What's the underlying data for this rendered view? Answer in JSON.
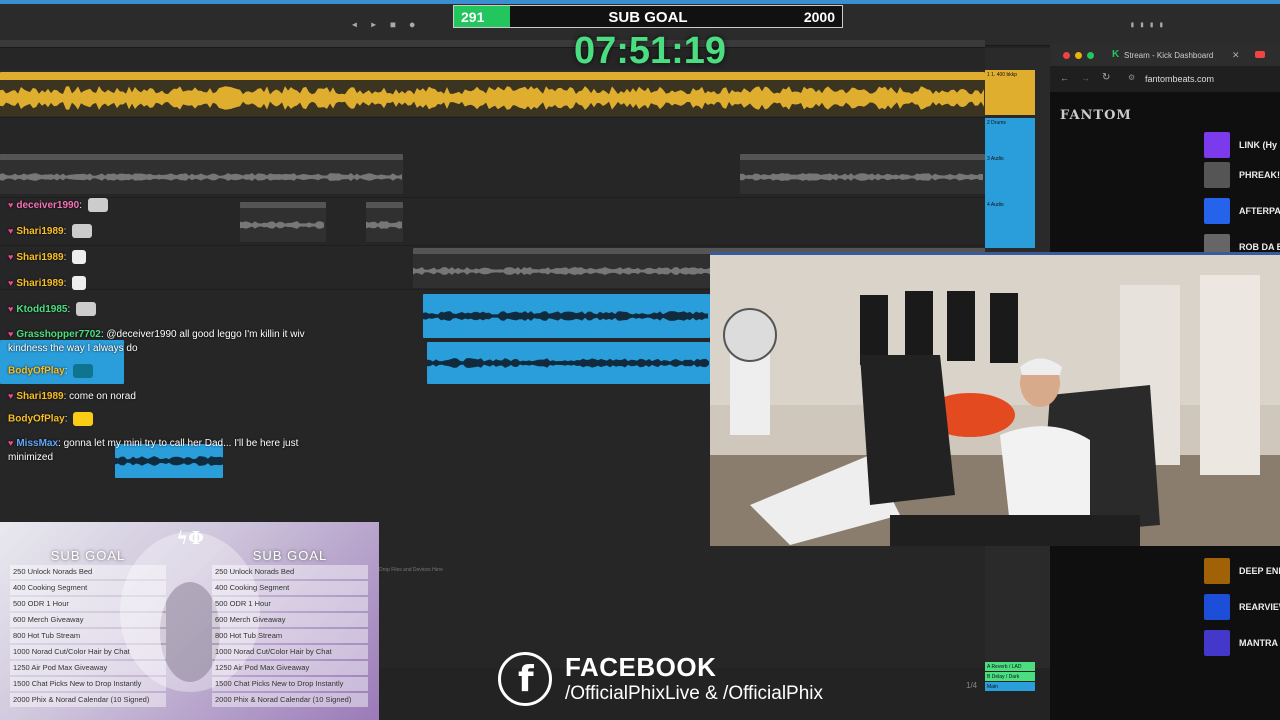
{
  "subgoal": {
    "current": "291",
    "title": "SUB GOAL",
    "target": "2000",
    "progress_fraction": 0.1455
  },
  "timer": "07:51:19",
  "daw": {
    "drop_hint": "Drop Files and Devices Here",
    "page": "1/4",
    "tracks": [
      "1 1. 400 bkkp",
      "2 Drums",
      "3 Audio",
      "4 Audio"
    ],
    "returns": [
      "A Reverb / LAD",
      "B Delay / Dark",
      "Main"
    ]
  },
  "chat": [
    {
      "user": "deceiver1990",
      "color": "#f472b6",
      "text": ""
    },
    {
      "user": "Shari1989",
      "color": "#fbbf24",
      "text": ""
    },
    {
      "user": "Shari1989",
      "color": "#fbbf24",
      "text": ""
    },
    {
      "user": "Shari1989",
      "color": "#fbbf24",
      "text": ""
    },
    {
      "user": "Ktodd1985",
      "color": "#4ade80",
      "text": ""
    },
    {
      "user": "Grasshopper7702",
      "color": "#4ade80",
      "text": "@deceiver1990 all good leggo I'm killin it wiv kindness the way I always do"
    },
    {
      "user": "BodyOfPlay",
      "color": "#fbbf24",
      "text": ""
    },
    {
      "user": "Shari1989",
      "color": "#fbbf24",
      "text": "come on norad"
    },
    {
      "user": "BodyOfPlay",
      "color": "#fbbf24",
      "text": ""
    },
    {
      "user": "MissMax",
      "color": "#60a5fa",
      "text": "gonna let my mini try to call her Dad... I'll be here just minimized"
    }
  ],
  "browser": {
    "tab_title": "Stream - Kick Dashboard",
    "url": "fantombeats.com",
    "brand": "FANTOM",
    "artists_top": [
      "LINK (Hy",
      "PHREAK!",
      "AFTERPA",
      "ROB DA B"
    ],
    "artists_bottom": [
      "DEEP END",
      "REARVIEW",
      "MANTRA"
    ]
  },
  "goals": {
    "heading": "SUB GOAL",
    "items": [
      "250 Unlock Norads Bed",
      "400 Cooking Segment",
      "500 ODR 1 Hour",
      "600 Merch Giveaway",
      "800 Hot Tub Stream",
      "1000 Norad Cut/Color Hair by Chat",
      "1250 Air Pod Max Giveaway",
      "1500 Chat Picks New to Drop Instantly",
      "2000 Phix & Norad Calendar (10 Signed)"
    ]
  },
  "facebook": {
    "title": "FACEBOOK",
    "handles": "/OfficialPhixLive & /OfficialPhix"
  },
  "colors": {
    "accent_green": "#22c55e",
    "clip_yellow": "#e0ae2e",
    "clip_blue": "#2a9ddb",
    "heart": "#ec4899"
  }
}
